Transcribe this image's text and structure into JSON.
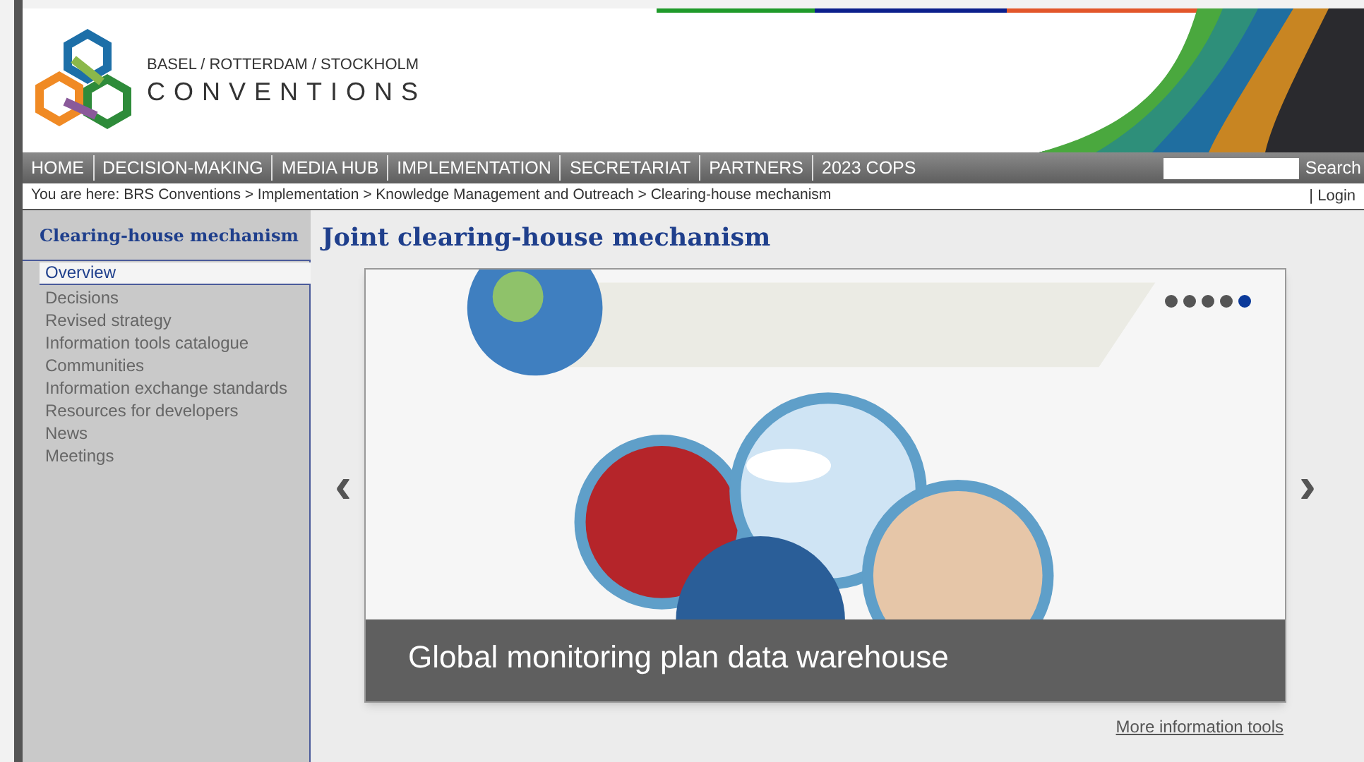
{
  "logo": {
    "tagline": "BASEL / ROTTERDAM / STOCKHOLM",
    "name": "CONVENTIONS"
  },
  "nav": {
    "items": [
      "HOME",
      "DECISION-MAKING",
      "MEDIA HUB",
      "IMPLEMENTATION",
      "SECRETARIAT",
      "PARTNERS",
      "2023 COPS"
    ],
    "search_button": "Search"
  },
  "breadcrumb": {
    "text": "You are here: BRS Conventions > Implementation > Knowledge Management and Outreach > Clearing-house mechanism",
    "login": "| Login"
  },
  "sidebar": {
    "title": "Clearing-house mechanism",
    "items": [
      {
        "label": "Overview",
        "selected": true
      },
      {
        "label": "Decisions",
        "selected": false
      },
      {
        "label": "Revised strategy",
        "selected": false
      },
      {
        "label": "Information tools catalogue",
        "selected": false
      },
      {
        "label": "Communities",
        "selected": false
      },
      {
        "label": "Information exchange standards",
        "selected": false
      },
      {
        "label": "Resources for developers",
        "selected": false
      },
      {
        "label": "News",
        "selected": false
      },
      {
        "label": "Meetings",
        "selected": false
      }
    ]
  },
  "main": {
    "title": "Joint clearing-house mechanism",
    "slider": {
      "kind": "picture",
      "caption": "Global monitoring plan data warehouse",
      "prev": "‹",
      "next": "›",
      "dots": [
        {
          "selected": false
        },
        {
          "selected": false
        },
        {
          "selected": false
        },
        {
          "selected": false
        },
        {
          "selected": true
        }
      ]
    },
    "link": "More information tools"
  }
}
